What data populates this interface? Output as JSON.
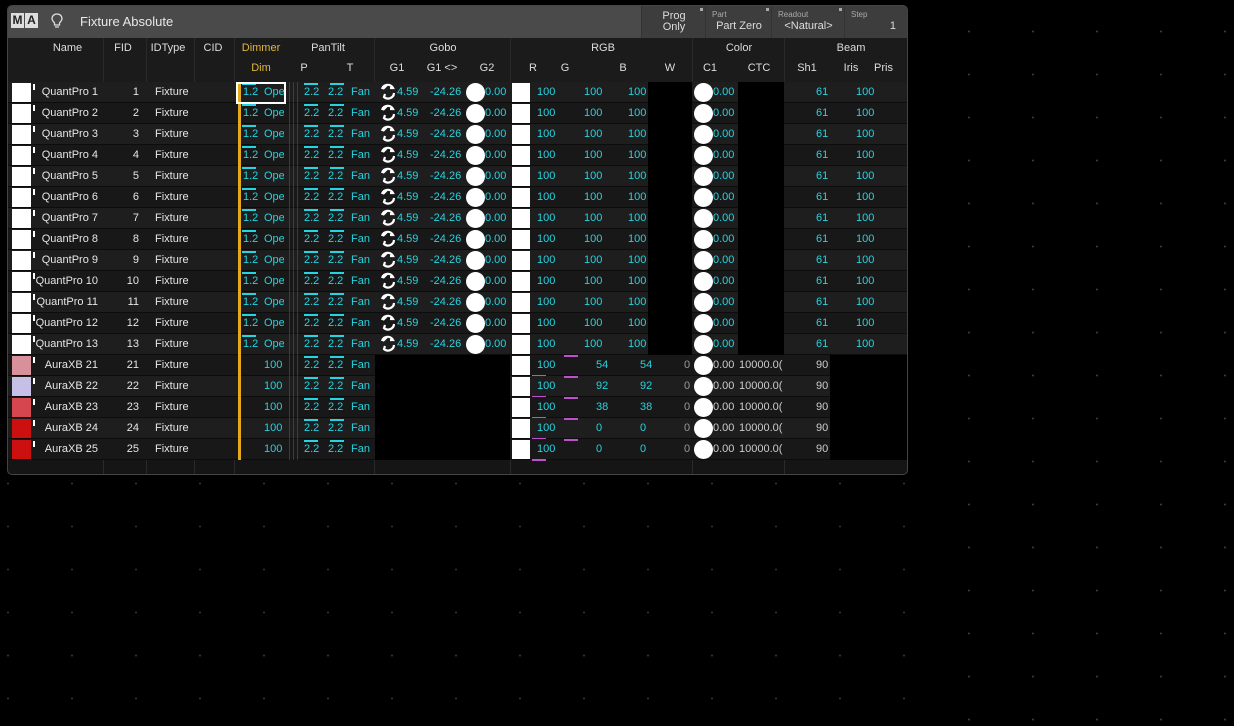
{
  "window": {
    "logo_m": "M",
    "logo_a": "A",
    "title": "Fixture Absolute",
    "prog": "Prog\nOnly",
    "part_label": "Part",
    "part_value": "Part Zero",
    "readout_label": "Readout",
    "readout_value": "<Natural>",
    "step_label": "Step",
    "step_value": "1"
  },
  "groups": {
    "dimmer": "Dimmer",
    "pantilt": "PanTilt",
    "gobo": "Gobo",
    "rgb": "RGB",
    "color": "Color",
    "beam": "Beam"
  },
  "columns": {
    "name": "Name",
    "fid": "FID",
    "idtype": "IDType",
    "cid": "CID",
    "dim": "Dim",
    "p": "P",
    "t": "T",
    "g1": "G1",
    "g1rot": "G1 <>",
    "g2": "G2",
    "r": "R",
    "g": "G",
    "b": "B",
    "w": "W",
    "c1": "C1",
    "ctc": "CTC",
    "sh1": "Sh1",
    "iris": "Iris",
    "pris": "Pris"
  },
  "colors": {
    "accent_cyan": "#26d3e0",
    "dimmer_yellow": "#e3a81c",
    "magenta": "#c04fd0"
  },
  "quantpro_values": {
    "dim": "1.2",
    "dim_label": "Ope",
    "p": "2.2",
    "t": "2.2",
    "fan": "Fan",
    "g1": "4.59",
    "g1rot": "-24.26",
    "g2": "0.00",
    "r": "100",
    "g": "100",
    "b": "100",
    "c1": "0.00",
    "sh1": "61",
    "iris": "100"
  },
  "aura_values": {
    "dim": "100",
    "p": "2.2",
    "t": "2.2",
    "fan": "Fan",
    "c1": "0.00",
    "ctc": "10000.0(",
    "sh1": "90",
    "w": "0"
  },
  "rows": [
    {
      "name": "QuantPro 1",
      "fid": "1",
      "idtype": "Fixture"
    },
    {
      "name": "QuantPro 2",
      "fid": "2",
      "idtype": "Fixture"
    },
    {
      "name": "QuantPro 3",
      "fid": "3",
      "idtype": "Fixture"
    },
    {
      "name": "QuantPro 4",
      "fid": "4",
      "idtype": "Fixture"
    },
    {
      "name": "QuantPro 5",
      "fid": "5",
      "idtype": "Fixture"
    },
    {
      "name": "QuantPro 6",
      "fid": "6",
      "idtype": "Fixture"
    },
    {
      "name": "QuantPro 7",
      "fid": "7",
      "idtype": "Fixture"
    },
    {
      "name": "QuantPro 8",
      "fid": "8",
      "idtype": "Fixture"
    },
    {
      "name": "QuantPro 9",
      "fid": "9",
      "idtype": "Fixture"
    },
    {
      "name": "QuantPro 10",
      "fid": "10",
      "idtype": "Fixture"
    },
    {
      "name": "QuantPro 11",
      "fid": "11",
      "idtype": "Fixture"
    },
    {
      "name": "QuantPro 12",
      "fid": "12",
      "idtype": "Fixture"
    },
    {
      "name": "QuantPro 13",
      "fid": "13",
      "idtype": "Fixture"
    },
    {
      "name": "AuraXB 21",
      "fid": "21",
      "idtype": "Fixture",
      "swatch": "#d8909a",
      "g": "54",
      "b": "54"
    },
    {
      "name": "AuraXB 22",
      "fid": "22",
      "idtype": "Fixture",
      "swatch": "#c6c0e6",
      "g": "92",
      "b": "92"
    },
    {
      "name": "AuraXB 23",
      "fid": "23",
      "idtype": "Fixture",
      "swatch": "#d6464e",
      "g": "38",
      "b": "38"
    },
    {
      "name": "AuraXB 24",
      "fid": "24",
      "idtype": "Fixture",
      "swatch": "#cc1010",
      "g": "0",
      "b": "0"
    },
    {
      "name": "AuraXB 25",
      "fid": "25",
      "idtype": "Fixture",
      "swatch": "#cc1010",
      "g": "0",
      "b": "0"
    }
  ]
}
